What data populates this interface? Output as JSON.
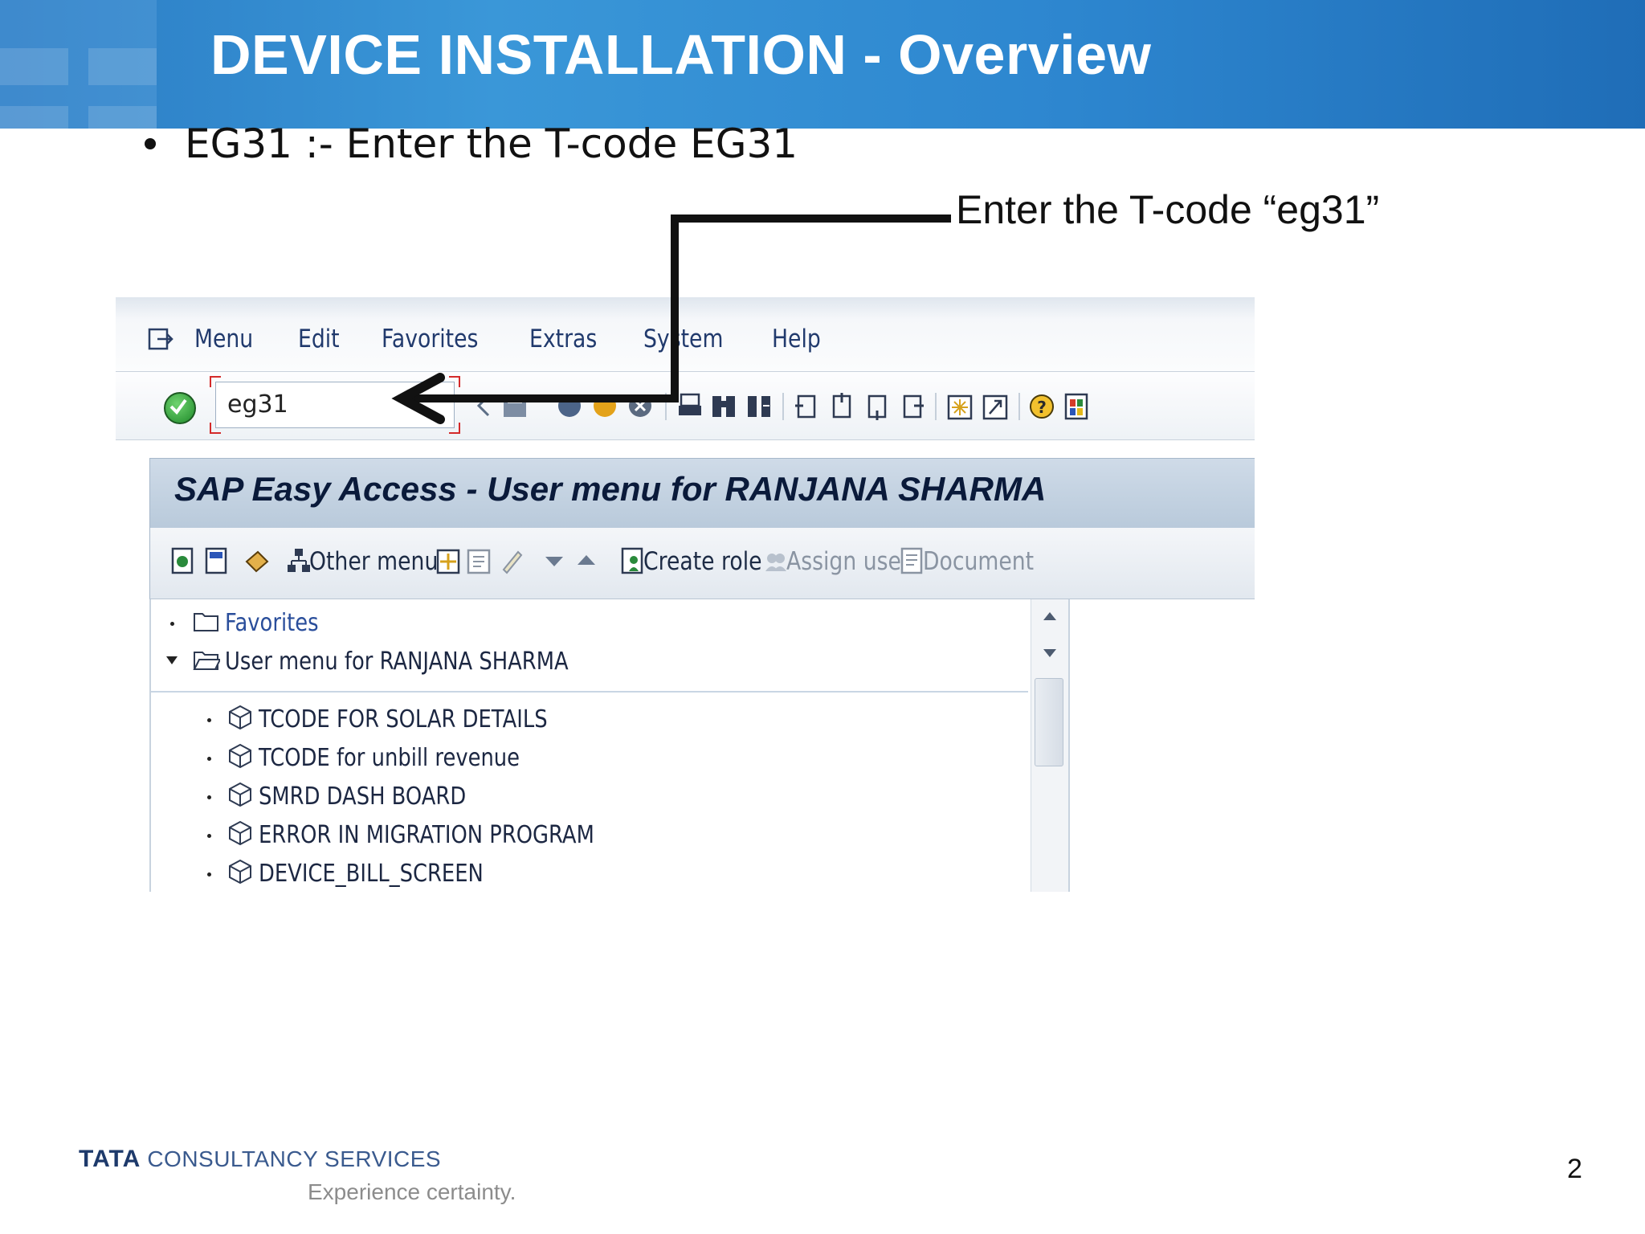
{
  "slide": {
    "title": "DEVICE INSTALLATION - Overview",
    "bullet": "EG31 :- Enter the T-code EG31",
    "callout": "Enter the T-code “eg31”",
    "page_number": "2"
  },
  "footer": {
    "brand_strong": "TATA",
    "brand_rest": "CONSULTANCY SERVICES",
    "tagline": "Experience certainty."
  },
  "sap": {
    "menu": [
      "Menu",
      "Edit",
      "Favorites",
      "Extras",
      "System",
      "Help"
    ],
    "command_field_value": "eg31",
    "screen_title": "SAP Easy Access  -  User menu for RANJANA SHARMA",
    "app_toolbar": {
      "other_menu": "Other menu",
      "create_role": "Create role",
      "assign_users": "Assign users",
      "documentation": "Document"
    },
    "tree": {
      "favorites": "Favorites",
      "user_menu": "User menu for RANJANA SHARMA",
      "items": [
        "TCODE FOR SOLAR DETAILS",
        "TCODE for unbill revenue",
        "SMRD DASH BOARD",
        "ERROR IN MIGRATION PROGRAM",
        "DEVICE_BILL_SCREEN"
      ]
    }
  },
  "colors": {
    "header_blue": "#2b7cc4",
    "sap_title_band": "#c3d2e2",
    "required_marker": "#d42a2a"
  }
}
